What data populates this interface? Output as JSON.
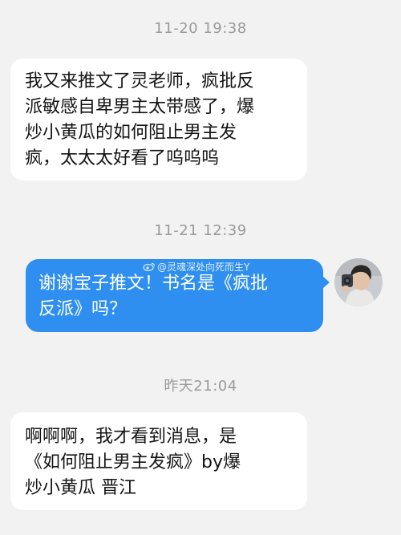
{
  "conversation": {
    "timestamps": [
      "11-20  19:38",
      "11-21  12:39",
      "昨天21:04"
    ],
    "messages": [
      {
        "direction": "incoming",
        "lines": [
          "我又来推文了灵老师，疯批反",
          "派敏感自卑男主太带感了，爆",
          "炒小黄瓜的如何阻止男主发",
          "疯，太太太好看了呜呜呜"
        ]
      },
      {
        "direction": "outgoing",
        "lines": [
          "谢谢宝子推文！书名是《疯批",
          "反派》吗？"
        ]
      },
      {
        "direction": "incoming",
        "lines": [
          "啊啊啊，我才看到消息，是",
          "《如何阻止男主发疯》by爆",
          "炒小黄瓜  晋江"
        ]
      }
    ]
  },
  "watermark": {
    "text": "@灵魂深处向死而生Y",
    "icon": "weibo-logo-icon"
  },
  "avatar": {
    "icon": "user-avatar-photo"
  },
  "colors": {
    "background": "#f2f2f2",
    "incoming_bubble": "#ffffff",
    "outgoing_bubble": "#2f8ff0",
    "timestamp": "#9a9a9a"
  }
}
